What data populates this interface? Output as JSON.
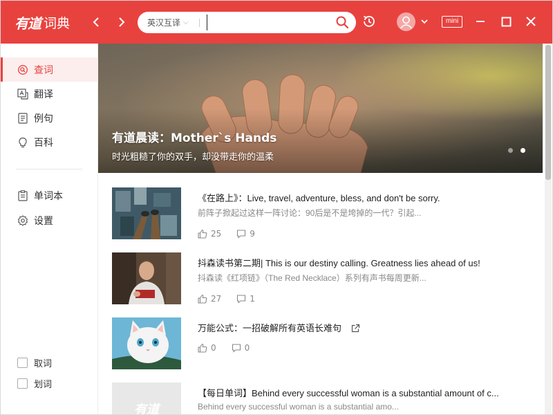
{
  "app": {
    "brand": "有道",
    "product": "词典"
  },
  "titlebar": {
    "back_icon": "chevron-left-icon",
    "forward_icon": "chevron-right-icon",
    "search": {
      "language": "英汉互译",
      "value": "",
      "placeholder": ""
    },
    "mini_label": "mini"
  },
  "sidebar": {
    "items": [
      {
        "label": "查词",
        "icon": "search-word-icon",
        "active": true
      },
      {
        "label": "翻译",
        "icon": "translate-icon",
        "active": false
      },
      {
        "label": "例句",
        "icon": "example-icon",
        "active": false
      },
      {
        "label": "百科",
        "icon": "bulb-icon",
        "active": false
      }
    ],
    "tools": [
      {
        "label": "单词本",
        "icon": "wordbook-icon"
      },
      {
        "label": "设置",
        "icon": "gear-icon"
      }
    ],
    "checks": [
      {
        "label": "取词",
        "checked": false
      },
      {
        "label": "划词",
        "checked": false
      }
    ]
  },
  "banner": {
    "title": "有道晨读：Mother`s Hands",
    "subtitle": "时光粗糙了你的双手，却没带走你的温柔",
    "slides": 2,
    "active_slide": 2
  },
  "articles": [
    {
      "title": "《在路上》：Live, travel, adventure, bless, and don't be sorry.",
      "desc": "前阵子掀起过这样一阵讨论：90后是不是垮掉的一代？引起...",
      "likes": "25",
      "comments": "9"
    },
    {
      "title": "抖森读书第二期| This is our destiny calling. Greatness lies ahead of us!",
      "desc": "抖森读《红项链》（The Red Necklace）系列有声书每周更新...",
      "likes": "27",
      "comments": "1"
    },
    {
      "title": "万能公式：一招破解所有英语长难句",
      "desc": "",
      "likes": "0",
      "comments": "0"
    },
    {
      "title": "【每日单词】Behind every successful woman is a substantial amount of c...",
      "desc": "Behind every successful woman is a substantial amo...",
      "likes": "",
      "comments": ""
    }
  ],
  "placeholder_thumb_text": "有道",
  "colors": {
    "accent": "#e8423f",
    "sidebar_active_bg": "#fbeeed"
  }
}
